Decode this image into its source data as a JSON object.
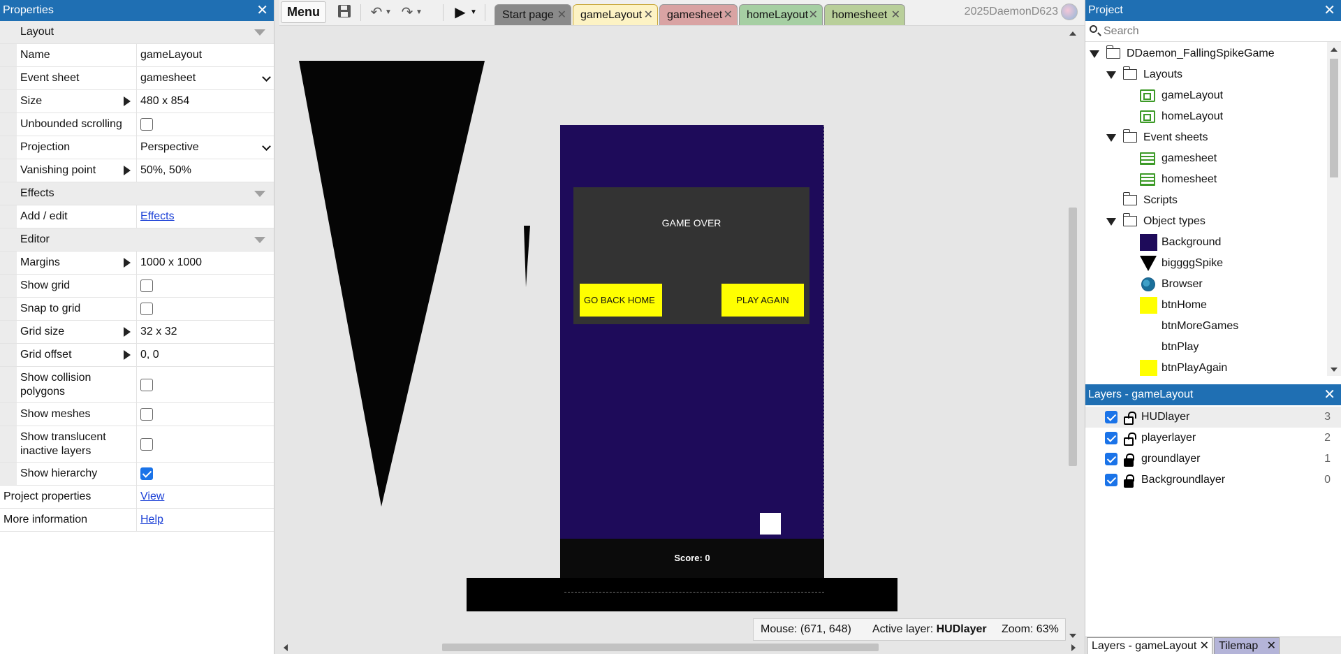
{
  "properties": {
    "title": "Properties",
    "close_icon": "close-icon",
    "sections": {
      "layout": "Layout",
      "effects": "Effects",
      "editor": "Editor"
    },
    "rows": {
      "name": {
        "label": "Name",
        "value": "gameLayout"
      },
      "event_sheet": {
        "label": "Event sheet",
        "value": "gamesheet"
      },
      "size": {
        "label": "Size",
        "value": "480 x 854"
      },
      "unbounded": {
        "label": "Unbounded scrolling",
        "checked": false
      },
      "projection": {
        "label": "Projection",
        "value": "Perspective"
      },
      "vanishing": {
        "label": "Vanishing point",
        "value": "50%, 50%"
      },
      "add_edit": {
        "label": "Add / edit",
        "value": "Effects"
      },
      "margins": {
        "label": "Margins",
        "value": "1000 x 1000"
      },
      "show_grid": {
        "label": "Show grid",
        "checked": false
      },
      "snap_grid": {
        "label": "Snap to grid",
        "checked": false
      },
      "grid_size": {
        "label": "Grid size",
        "value": "32 x 32"
      },
      "grid_offset": {
        "label": "Grid offset",
        "value": "0, 0"
      },
      "collision": {
        "label": "Show collision polygons",
        "checked": false
      },
      "meshes": {
        "label": "Show meshes",
        "checked": false
      },
      "translucent": {
        "label": "Show translucent inactive layers",
        "checked": false
      },
      "hierarchy": {
        "label": "Show hierarchy",
        "checked": true
      },
      "project_props": {
        "label": "Project properties",
        "value": "View"
      },
      "more_info": {
        "label": "More information",
        "value": "Help"
      }
    }
  },
  "toolbar": {
    "menu_label": "Menu",
    "save_icon": "save-icon",
    "undo_icon": "undo-icon",
    "redo_icon": "redo-icon",
    "play_icon": "play-icon",
    "user": "2025DaemonD623",
    "tabs": [
      {
        "label": "Start page",
        "color": "#8a8a8a"
      },
      {
        "label": "gameLayout",
        "color": "#fdf3c4",
        "active": true
      },
      {
        "label": "gamesheet",
        "color": "#d9a3a3"
      },
      {
        "label": "homeLayout",
        "color": "#a6cfa3"
      },
      {
        "label": "homesheet",
        "color": "#b9cf9a"
      }
    ]
  },
  "canvas": {
    "game_over": "GAME OVER",
    "btn_home": "GO BACK HOME",
    "btn_play_again": "PLAY AGAIN",
    "score": "Score: 0",
    "colors": {
      "background": "#1e0b5a",
      "panel": "#333333",
      "button": "#ffff00",
      "ground": "#0b0b0b"
    }
  },
  "status": {
    "mouse_label": "Mouse:",
    "mouse_value": "(671, 648)",
    "active_label": "Active layer:",
    "active_value": "HUDlayer",
    "zoom_label": "Zoom:",
    "zoom_value": "63%"
  },
  "project": {
    "title": "Project",
    "search_placeholder": "Search",
    "root": "DDaemon_FallingSpikeGame",
    "layouts_folder": "Layouts",
    "layouts": [
      "gameLayout",
      "homeLayout"
    ],
    "eventsheets_folder": "Event sheets",
    "eventsheets": [
      "gamesheet",
      "homesheet"
    ],
    "scripts_folder": "Scripts",
    "objecttypes_folder": "Object types",
    "objects": [
      "Background",
      "biggggSpike",
      "Browser",
      "btnHome",
      "btnMoreGames",
      "btnPlay",
      "btnPlayAgain"
    ]
  },
  "layers": {
    "title": "Layers - gameLayout",
    "items": [
      {
        "name": "HUDlayer",
        "index": "3",
        "locked": false
      },
      {
        "name": "playerlayer",
        "index": "2",
        "locked": false
      },
      {
        "name": "groundlayer",
        "index": "1",
        "locked": true
      },
      {
        "name": "Backgroundlayer",
        "index": "0",
        "locked": true
      }
    ],
    "bottom_tabs": [
      "Layers - gameLayout",
      "Tilemap"
    ]
  }
}
